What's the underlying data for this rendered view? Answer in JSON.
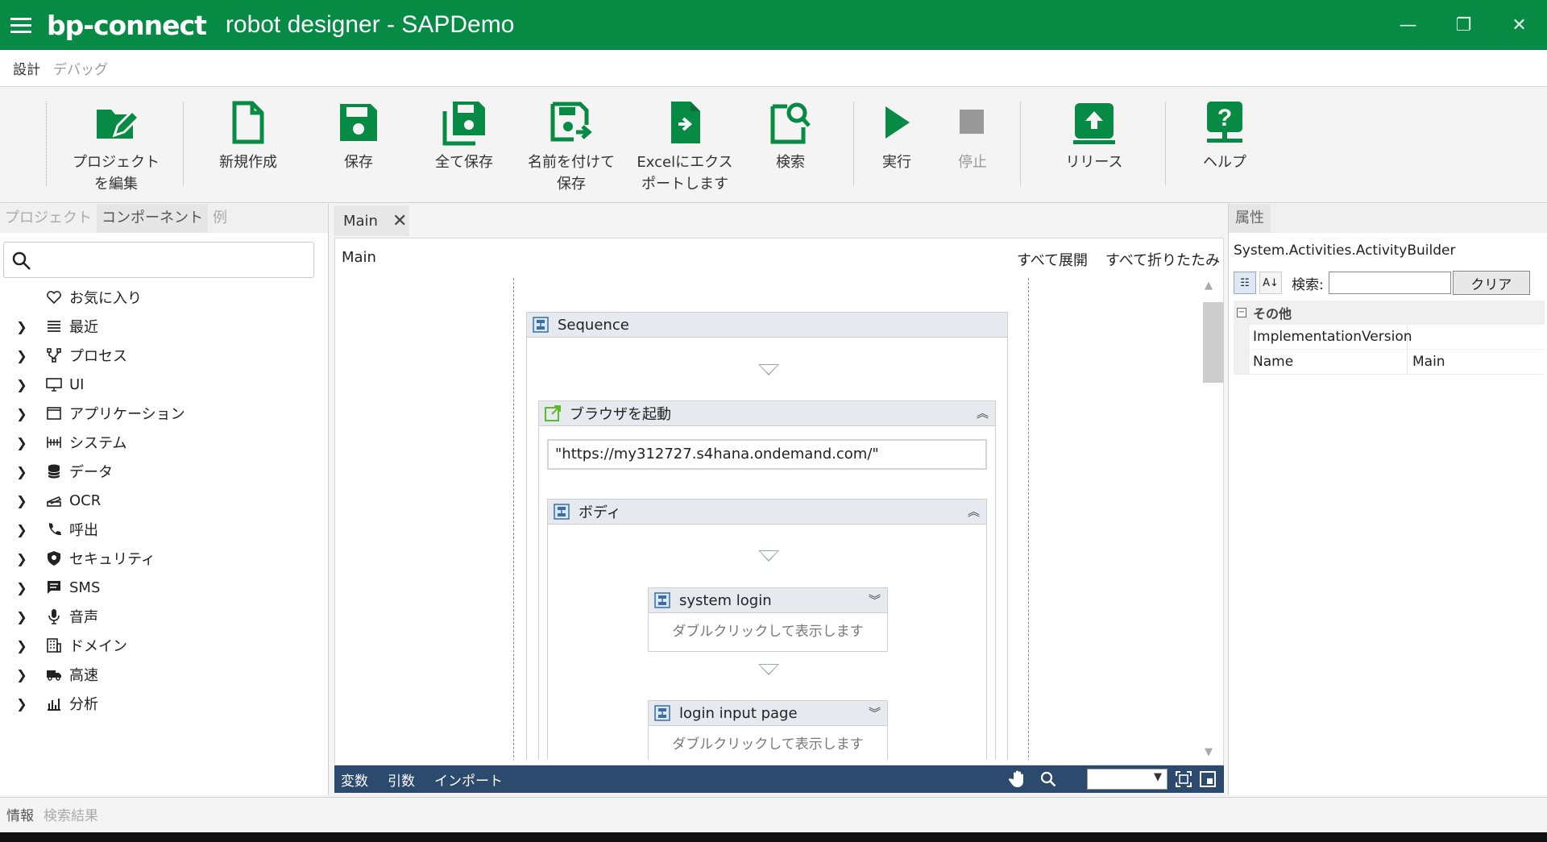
{
  "app": {
    "logo": "bp-connect",
    "title": "robot designer - SAPDemo",
    "brand_color": "#068a44"
  },
  "menu_tabs": [
    {
      "label": "設計",
      "active": true
    },
    {
      "label": "デバッグ",
      "active": false
    }
  ],
  "ribbon": {
    "edit_project": "プロジェクト\nを編集",
    "new": "新規作成",
    "save": "保存",
    "save_all": "全て保存",
    "save_as": "名前を付けて\n保存",
    "export_excel": "Excelにエクス\nポートします",
    "search": "検索",
    "run": "実行",
    "stop": "停止",
    "release": "リリース",
    "help": "ヘルプ"
  },
  "left_panel": {
    "tabs": [
      "プロジェクト",
      "コンポーネント",
      "例"
    ],
    "active_tab": "コンポーネント",
    "search_placeholder": "",
    "items": [
      {
        "label": "お気に入り",
        "icon": "heart-icon",
        "expandable": false
      },
      {
        "label": "最近",
        "icon": "list-icon",
        "expandable": true
      },
      {
        "label": "プロセス",
        "icon": "process-icon",
        "expandable": true
      },
      {
        "label": "UI",
        "icon": "monitor-icon",
        "expandable": true
      },
      {
        "label": "アプリケーション",
        "icon": "window-icon",
        "expandable": true
      },
      {
        "label": "システム",
        "icon": "system-icon",
        "expandable": true
      },
      {
        "label": "データ",
        "icon": "database-icon",
        "expandable": true
      },
      {
        "label": "OCR",
        "icon": "scanner-icon",
        "expandable": true
      },
      {
        "label": "呼出",
        "icon": "phone-icon",
        "expandable": true
      },
      {
        "label": "セキュリティ",
        "icon": "shield-icon",
        "expandable": true
      },
      {
        "label": "SMS",
        "icon": "message-icon",
        "expandable": true
      },
      {
        "label": "音声",
        "icon": "microphone-icon",
        "expandable": true
      },
      {
        "label": "ドメイン",
        "icon": "building-icon",
        "expandable": true
      },
      {
        "label": "高速",
        "icon": "truck-icon",
        "expandable": true
      },
      {
        "label": "分析",
        "icon": "analytics-icon",
        "expandable": true
      }
    ]
  },
  "document": {
    "tab_label": "Main",
    "breadcrumb": "Main",
    "expand_all": "すべて展開",
    "collapse_all": "すべて折りたたみ",
    "sequence_label": "Sequence",
    "browser_label": "ブラウザを起動",
    "url_value": "\"https://my312727.s4hana.ondemand.com/\"",
    "body_label": "ボディ",
    "activities": [
      {
        "label": "system login",
        "hint": "ダブルクリックして表示します"
      },
      {
        "label": "login input page",
        "hint": "ダブルクリックして表示します"
      }
    ]
  },
  "designer_footer": {
    "variables": "変数",
    "arguments": "引数",
    "imports": "インポート",
    "zoom_value": ""
  },
  "properties": {
    "tab_label": "属性",
    "type_name": "System.Activities.ActivityBuilder",
    "search_label": "検索:",
    "search_value": "",
    "clear_label": "クリア",
    "category": "その他",
    "rows": [
      {
        "key": "ImplementationVersion",
        "value": ""
      },
      {
        "key": "Name",
        "value": "Main"
      }
    ]
  },
  "bottom_tabs": [
    {
      "label": "情報",
      "active": true
    },
    {
      "label": "検索結果",
      "active": false
    }
  ]
}
